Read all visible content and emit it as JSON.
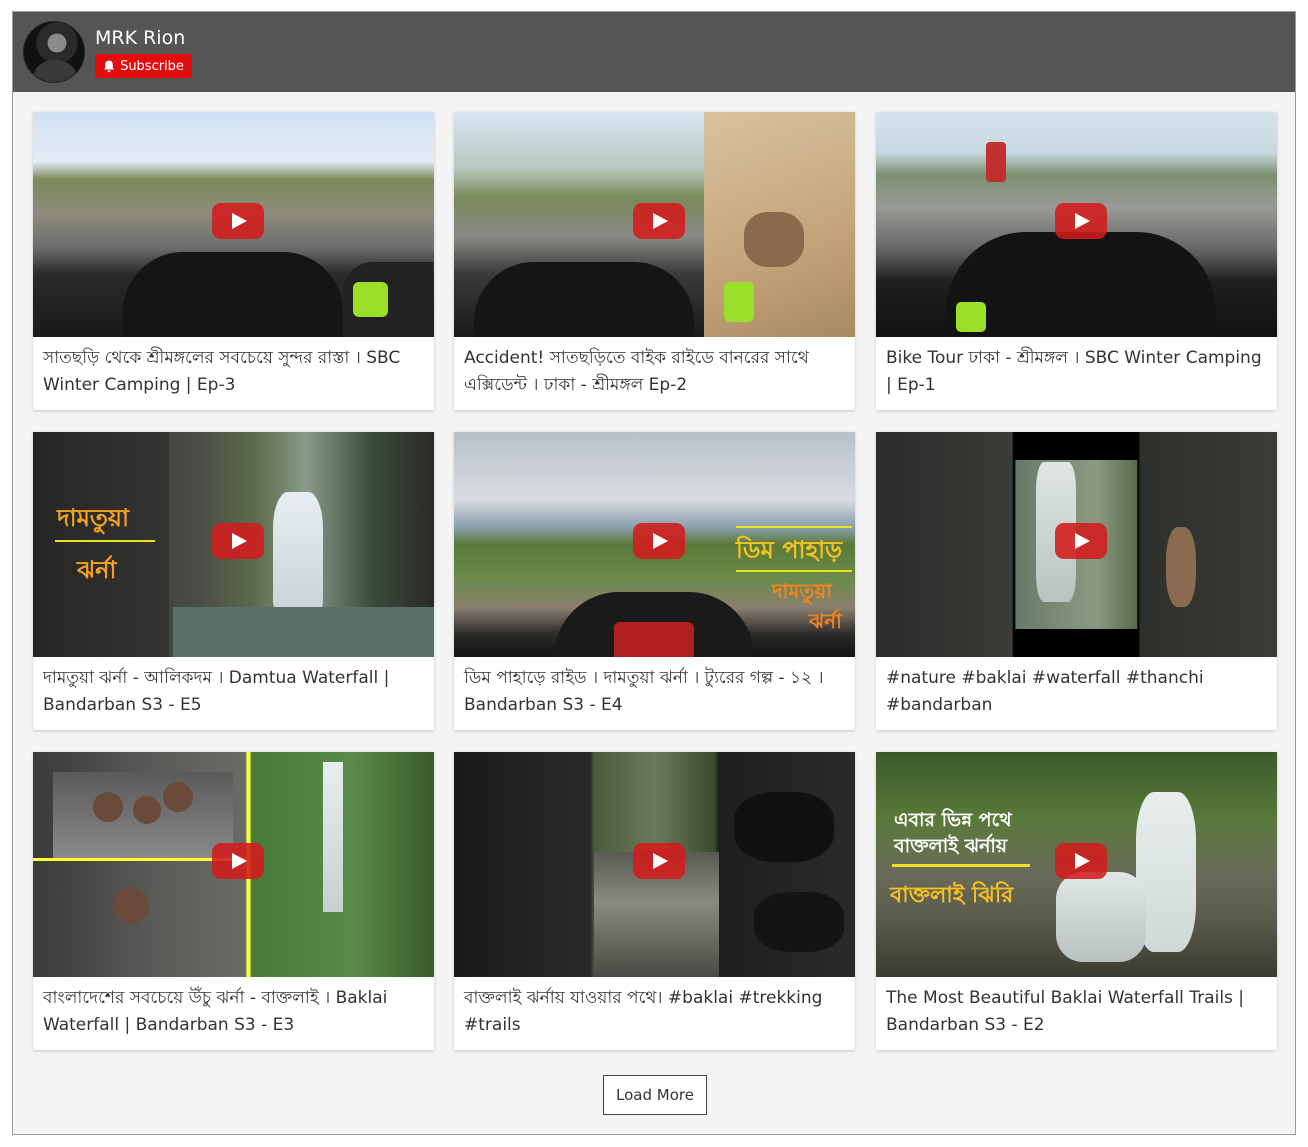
{
  "channel": {
    "name": "MRK Rion",
    "subscribe_label": "Subscribe"
  },
  "videos": [
    {
      "title": "সাতছড়ি থেকে শ্রীমঙ্গলের সবচেয়ে সুন্দর রাস্তা । SBC Winter Camping | Ep-3"
    },
    {
      "title": "Accident! সাতছড়িতে বাইক রাইডে বানরের সাথে এক্সিডেন্ট । ঢাকা - শ্রীমঙ্গল Ep-2"
    },
    {
      "title": "Bike Tour ঢাকা - শ্রীমঙ্গল । SBC Winter Camping | Ep-1"
    },
    {
      "title": "দামতুয়া ঝর্না - আলিকদম । Damtua Waterfall | Bandarban S3 - E5",
      "overlay": [
        "দামতুয়া",
        "ঝর্না"
      ]
    },
    {
      "title": "ডিম পাহাড়ে রাইড । দামতুয়া ঝর্না । ট্যুরের গল্প - ১২ । Bandarban S3 - E4",
      "overlay": [
        "ডিম পাহাড়",
        "দামতুয়া",
        "ঝর্না"
      ]
    },
    {
      "title": "#nature #baklai #waterfall #thanchi #bandarban"
    },
    {
      "title": "বাংলাদেশের সবচেয়ে উঁচু ঝর্না - বাক্তলাই । Baklai Waterfall | Bandarban S3 - E3"
    },
    {
      "title": "বাক্তলাই ঝর্নায় যাওয়ার পথে। #baklai #trekking #trails"
    },
    {
      "title": "The Most Beautiful Baklai Waterfall Trails | Bandarban S3 - E2",
      "overlay": [
        "এবার ভিন্ন পথে",
        "বাক্তলাই ঝর্নায়",
        "বাক্তলাই ঝিরি"
      ]
    }
  ],
  "load_more_label": "Load More",
  "colors": {
    "header_bg": "#555555",
    "subscribe_bg": "#e20e0e",
    "play_button": "#d31b1b"
  }
}
